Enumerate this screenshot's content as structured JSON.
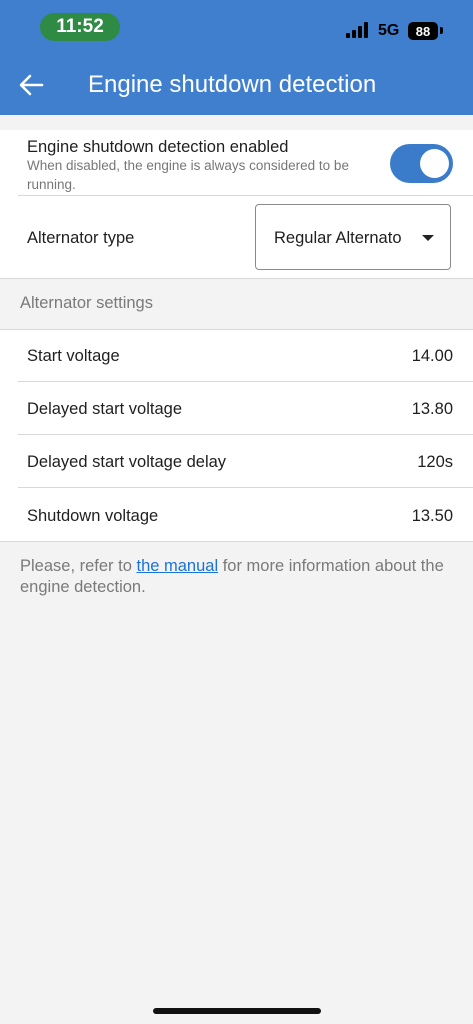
{
  "status_bar": {
    "time": "11:52",
    "network": "5G",
    "battery": "88"
  },
  "header": {
    "title": "Engine shutdown detection"
  },
  "shutdown_detection": {
    "title": "Engine shutdown detection enabled",
    "description": "When disabled, the engine is always considered to be running.",
    "enabled": true
  },
  "alternator": {
    "label": "Alternator type",
    "selected": "Regular Alternato"
  },
  "alternator_settings": {
    "header": "Alternator settings",
    "rows": [
      {
        "label": "Start voltage",
        "value": "14.00"
      },
      {
        "label": "Delayed start voltage",
        "value": "13.80"
      },
      {
        "label": "Delayed start voltage delay",
        "value": "120s"
      },
      {
        "label": "Shutdown voltage",
        "value": "13.50"
      }
    ]
  },
  "footer": {
    "prefix": "Please, refer to ",
    "link": "the manual",
    "suffix": " for more information about the engine detection."
  },
  "colors": {
    "header": "#3f7fce",
    "toggle_on": "#3a7cc9",
    "link": "#1a73d9",
    "time_pill": "#2f8a44"
  }
}
